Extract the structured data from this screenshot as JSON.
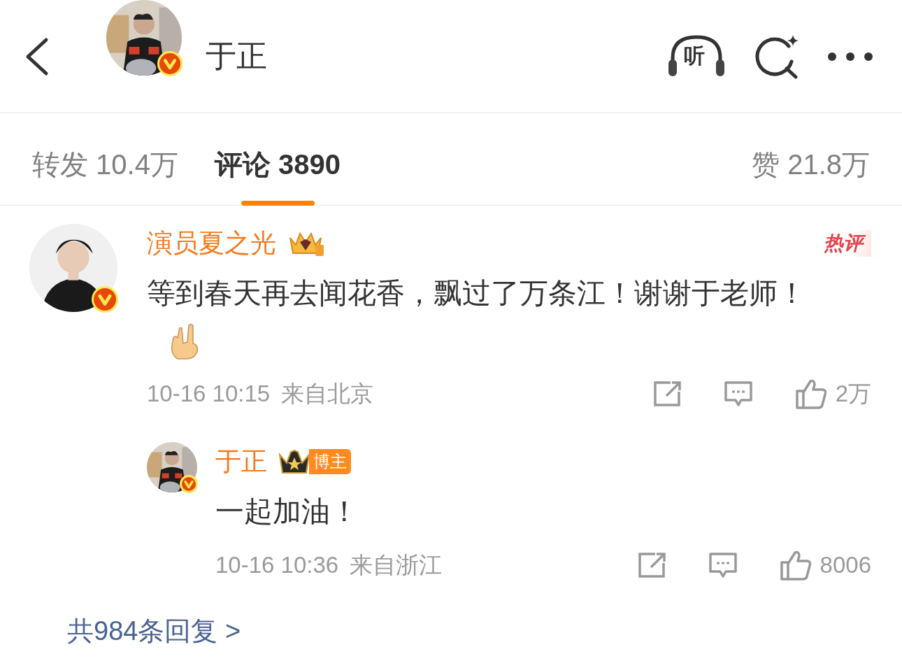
{
  "header": {
    "title": "于正",
    "verified": true,
    "listen_label": "听"
  },
  "tabs": [
    {
      "label": "转发",
      "count": "10.4万",
      "selected": false
    },
    {
      "label": "评论",
      "count": "3890",
      "selected": true
    },
    {
      "label": "赞",
      "count": "21.8万",
      "selected": false
    }
  ],
  "comment": {
    "author": "演员夏之光",
    "verified": true,
    "hot_badge": "热评",
    "text": "等到春天再去闻花香，飘过了万条江！谢谢于老师！",
    "time": "10-16 10:15",
    "location": "来自北京",
    "likes": "2万",
    "reply": {
      "author": "于正",
      "verified": true,
      "author_badge": "博主",
      "text": "一起加油！",
      "time": "10-16 10:36",
      "location": "来自浙江",
      "likes": "8006"
    },
    "more_replies": "共984条回复 >"
  }
}
